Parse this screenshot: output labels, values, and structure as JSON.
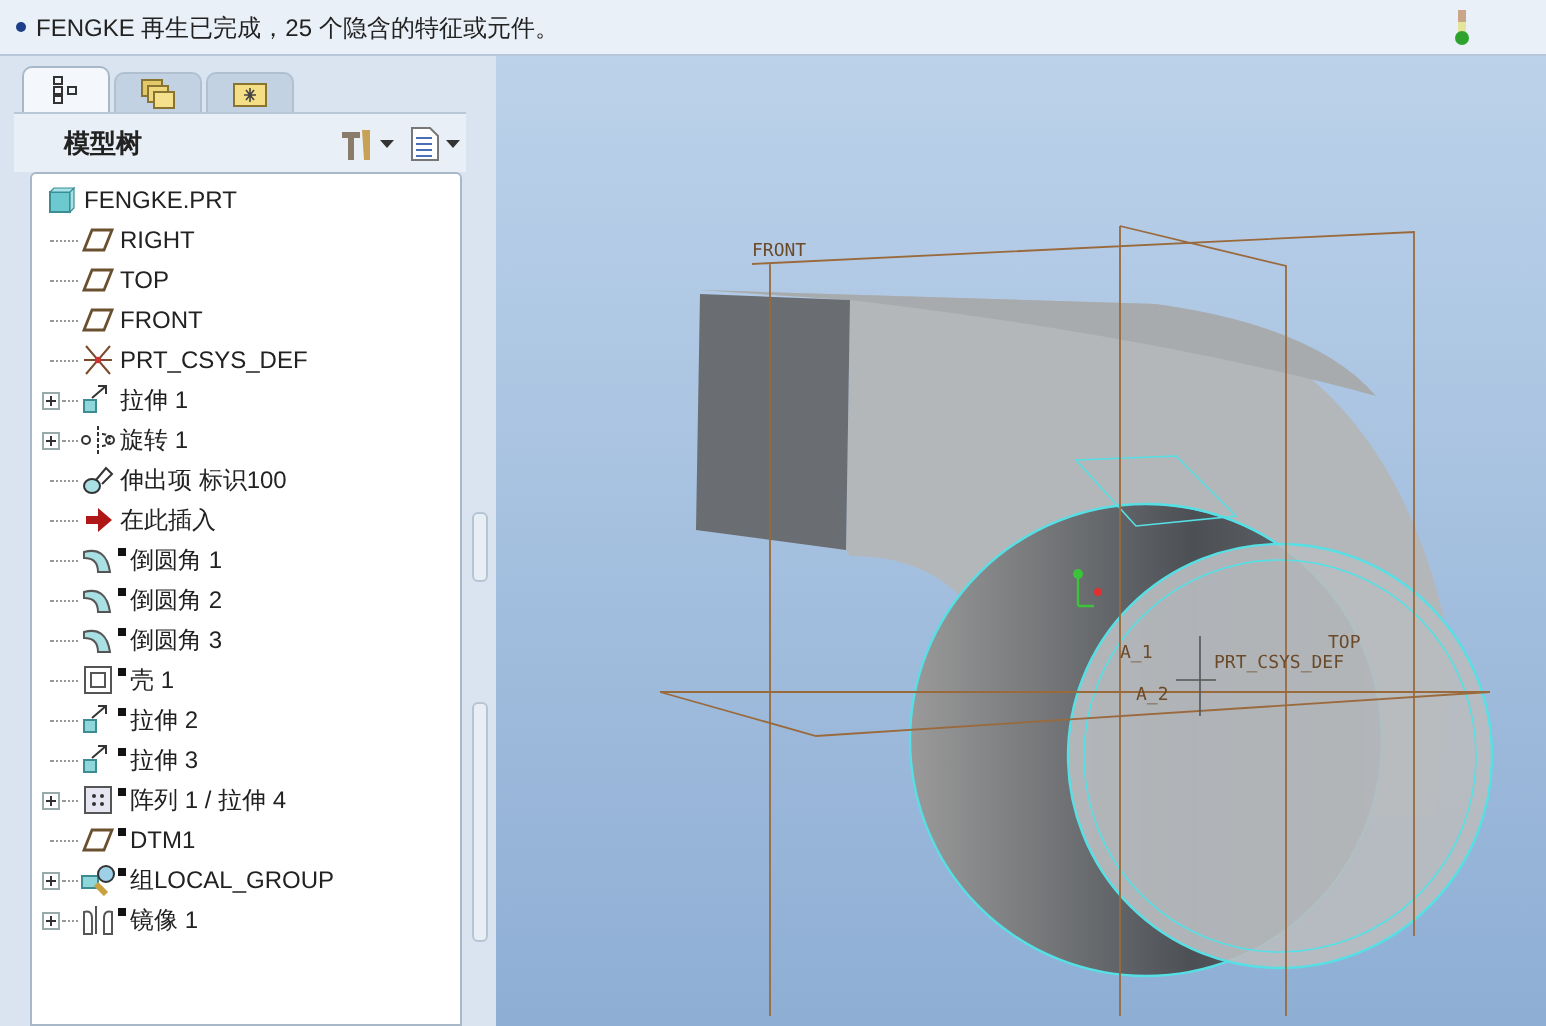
{
  "message_bar": {
    "message": "FENGKE 再生已完成，25 个隐含的特征或元件。"
  },
  "panel_tabs": [
    {
      "kind": "tree",
      "selected": true
    },
    {
      "kind": "folders",
      "selected": false
    },
    {
      "kind": "favorites",
      "selected": false
    }
  ],
  "model_tree": {
    "title": "模型树",
    "root": {
      "label": "FENGKE.PRT",
      "kind": "part",
      "children": [
        {
          "label": "RIGHT",
          "kind": "plane",
          "collapsed": false,
          "marked": false
        },
        {
          "label": "TOP",
          "kind": "plane",
          "collapsed": false,
          "marked": false
        },
        {
          "label": "FRONT",
          "kind": "plane",
          "collapsed": false,
          "marked": false
        },
        {
          "label": "PRT_CSYS_DEF",
          "kind": "csys",
          "collapsed": false,
          "marked": false
        },
        {
          "label": "拉伸 1",
          "kind": "extrude",
          "collapsed": true,
          "marked": false
        },
        {
          "label": "旋转 1",
          "kind": "revolve",
          "collapsed": true,
          "marked": false
        },
        {
          "label": "伸出项 标识100",
          "kind": "protrusion",
          "collapsed": false,
          "marked": false
        },
        {
          "label": "在此插入",
          "kind": "insert",
          "collapsed": false,
          "marked": false
        },
        {
          "label": "倒圆角 1",
          "kind": "round",
          "collapsed": false,
          "marked": true
        },
        {
          "label": "倒圆角 2",
          "kind": "round",
          "collapsed": false,
          "marked": true
        },
        {
          "label": "倒圆角 3",
          "kind": "round",
          "collapsed": false,
          "marked": true
        },
        {
          "label": "壳 1",
          "kind": "shell",
          "collapsed": false,
          "marked": true
        },
        {
          "label": "拉伸 2",
          "kind": "extrude",
          "collapsed": false,
          "marked": true
        },
        {
          "label": "拉伸 3",
          "kind": "extrude",
          "collapsed": false,
          "marked": true
        },
        {
          "label": "阵列 1 / 拉伸 4",
          "kind": "pattern",
          "collapsed": true,
          "marked": true
        },
        {
          "label": "DTM1",
          "kind": "plane",
          "collapsed": false,
          "marked": true
        },
        {
          "label": "组LOCAL_GROUP",
          "kind": "group",
          "collapsed": true,
          "marked": true
        },
        {
          "label": "镜像 1",
          "kind": "mirror",
          "collapsed": true,
          "marked": true
        }
      ]
    }
  },
  "viewport": {
    "labels": [
      "FRONT",
      "TOP",
      "A_1",
      "PRT_CSYS_DEF",
      "A_2"
    ]
  }
}
